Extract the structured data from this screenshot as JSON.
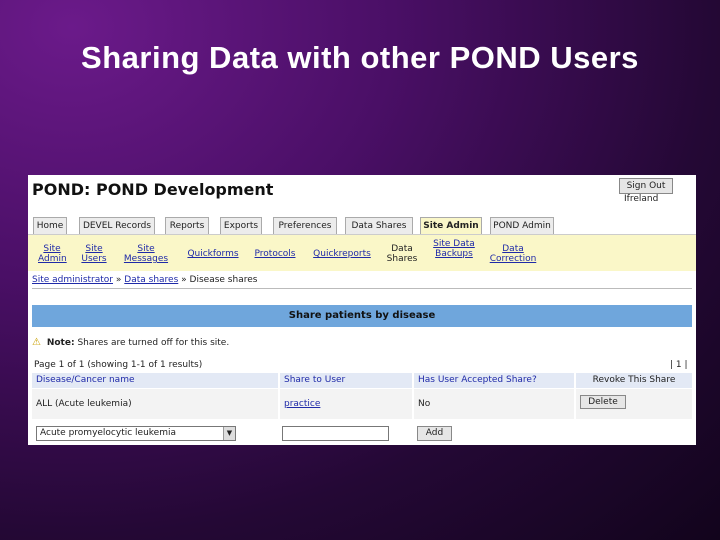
{
  "slide": {
    "title": "Sharing Data with other POND Users"
  },
  "app": {
    "title": "POND: POND Development",
    "signout_label": "Sign Out",
    "user_name": "Ifreland"
  },
  "tabs": [
    {
      "label": "Home"
    },
    {
      "label": "DEVEL Records"
    },
    {
      "label": "Reports"
    },
    {
      "label": "Exports"
    },
    {
      "label": "Preferences"
    },
    {
      "label": "Data Shares"
    },
    {
      "label": "Site Admin",
      "active": true
    },
    {
      "label": "POND Admin"
    }
  ],
  "subnav": [
    {
      "label": "Site Admin"
    },
    {
      "label": "Site Users"
    },
    {
      "label": "Site Messages"
    },
    {
      "label": "Quickforms"
    },
    {
      "label": "Protocols"
    },
    {
      "label": "Quickreports"
    },
    {
      "label": "Data Shares",
      "current": true
    },
    {
      "label": "Site Data Backups"
    },
    {
      "label": "Data Correction"
    }
  ],
  "breadcrumb": {
    "items": [
      "Site administrator",
      "Data shares"
    ],
    "current": "Disease shares",
    "separator": "»"
  },
  "section": {
    "title": "Share patients by disease"
  },
  "note": {
    "prefix": "Note:",
    "text": "Shares are turned off for this site."
  },
  "pager": {
    "text": "Page 1 of 1 (showing 1-1 of 1 results)",
    "pages": "| 1 |"
  },
  "table": {
    "headers": [
      "Disease/Cancer name",
      "Share to User",
      "Has User Accepted Share?",
      "Revoke This Share"
    ],
    "rows": [
      {
        "disease": "ALL (Acute leukemia)",
        "user": "practice",
        "accepted": "No",
        "action": "Delete"
      }
    ]
  },
  "add_form": {
    "select_value": "Acute promyelocytic leukemia",
    "input_value": "",
    "add_label": "Add"
  },
  "colors": {
    "section_bar": "#6fa6dc",
    "subnav_bg": "#faf7c8",
    "link": "#1f2aa8"
  }
}
